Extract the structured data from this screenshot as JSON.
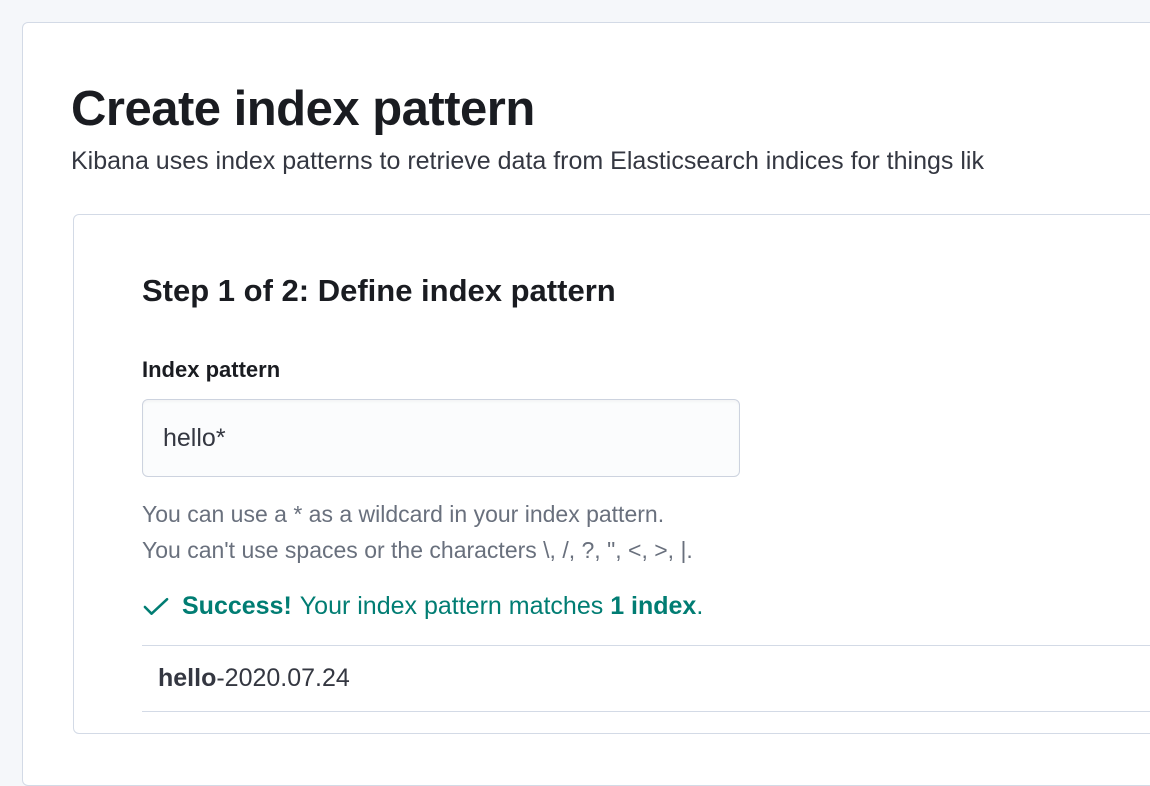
{
  "page": {
    "title": "Create index pattern",
    "subtitle": "Kibana uses index patterns to retrieve data from Elasticsearch indices for things lik"
  },
  "step": {
    "title": "Step 1 of 2: Define index pattern"
  },
  "field": {
    "label": "Index pattern",
    "value": "hello*",
    "help_line1": "You can use a * as a wildcard in your index pattern.",
    "help_line2": "You can't use spaces or the characters \\, /, ?, \", <, >, |."
  },
  "success": {
    "prefix": "Success!",
    "text_before": " Your index pattern matches ",
    "count": "1 index",
    "text_after": "."
  },
  "results": {
    "item_bold": "hello",
    "item_rest": "-2020.07.24"
  }
}
